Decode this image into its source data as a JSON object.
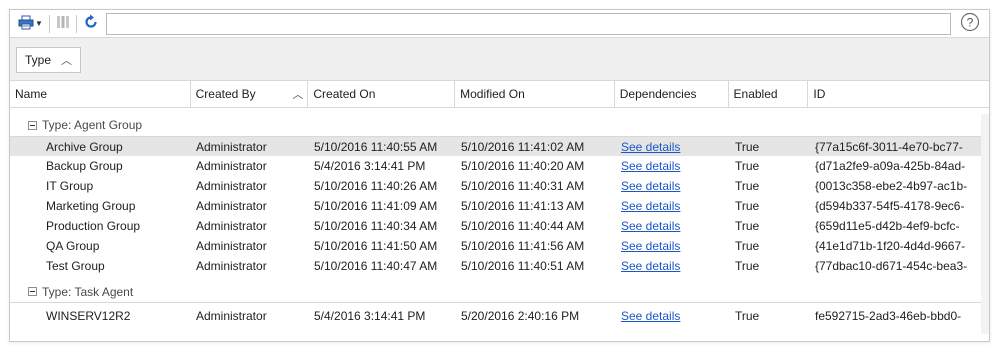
{
  "toolbar": {
    "print_icon": "printer-icon",
    "columns_icon": "columns-icon",
    "refresh_icon": "refresh-icon",
    "help_icon": "help-icon",
    "search_value": ""
  },
  "group_by": {
    "label": "Type",
    "sort": "ascending"
  },
  "columns": [
    {
      "label": "Name"
    },
    {
      "label": "Created By",
      "sorted": "ascending"
    },
    {
      "label": "Created On"
    },
    {
      "label": "Modified On"
    },
    {
      "label": "Dependencies"
    },
    {
      "label": "Enabled"
    },
    {
      "label": "ID"
    }
  ],
  "groups": [
    {
      "label": "Type: Agent Group",
      "rows": [
        {
          "name": "Archive Group",
          "created_by": "Administrator",
          "created_on": "5/10/2016 11:40:55 AM",
          "modified_on": "5/10/2016 11:41:02 AM",
          "dependencies": "See details",
          "enabled": "True",
          "id": "{77a15c6f-3011-4e70-bc77-",
          "selected": true
        },
        {
          "name": "Backup Group",
          "created_by": "Administrator",
          "created_on": "5/4/2016 3:14:41 PM",
          "modified_on": "5/10/2016 11:40:20 AM",
          "dependencies": "See details",
          "enabled": "True",
          "id": "{d71a2fe9-a09a-425b-84ad-"
        },
        {
          "name": "IT Group",
          "created_by": "Administrator",
          "created_on": "5/10/2016 11:40:26 AM",
          "modified_on": "5/10/2016 11:40:31 AM",
          "dependencies": "See details",
          "enabled": "True",
          "id": "{0013c358-ebe2-4b97-ac1b-"
        },
        {
          "name": "Marketing Group",
          "created_by": "Administrator",
          "created_on": "5/10/2016 11:41:09 AM",
          "modified_on": "5/10/2016 11:41:13 AM",
          "dependencies": "See details",
          "enabled": "True",
          "id": "{d594b337-54f5-4178-9ec6-"
        },
        {
          "name": "Production Group",
          "created_by": "Administrator",
          "created_on": "5/10/2016 11:40:34 AM",
          "modified_on": "5/10/2016 11:40:44 AM",
          "dependencies": "See details",
          "enabled": "True",
          "id": "{659d11e5-d42b-4ef9-bcfc-"
        },
        {
          "name": "QA Group",
          "created_by": "Administrator",
          "created_on": "5/10/2016 11:41:50 AM",
          "modified_on": "5/10/2016 11:41:56 AM",
          "dependencies": "See details",
          "enabled": "True",
          "id": "{41e1d71b-1f20-4d4d-9667-"
        },
        {
          "name": "Test Group",
          "created_by": "Administrator",
          "created_on": "5/10/2016 11:40:47 AM",
          "modified_on": "5/10/2016 11:40:51 AM",
          "dependencies": "See details",
          "enabled": "True",
          "id": "{77dbac10-d671-454c-bea3-"
        }
      ]
    },
    {
      "label": "Type: Task Agent",
      "rows": [
        {
          "name": "WINSERV12R2",
          "created_by": "Administrator",
          "created_on": "5/4/2016 3:14:41 PM",
          "modified_on": "5/20/2016 2:40:16 PM",
          "dependencies": "See details",
          "enabled": "True",
          "id": "fe592715-2ad3-46eb-bbd0-"
        }
      ]
    }
  ],
  "colors": {
    "link": "#1a55c9",
    "selected_row": "#e5e5e5",
    "refresh_icon": "#1f66c9"
  }
}
